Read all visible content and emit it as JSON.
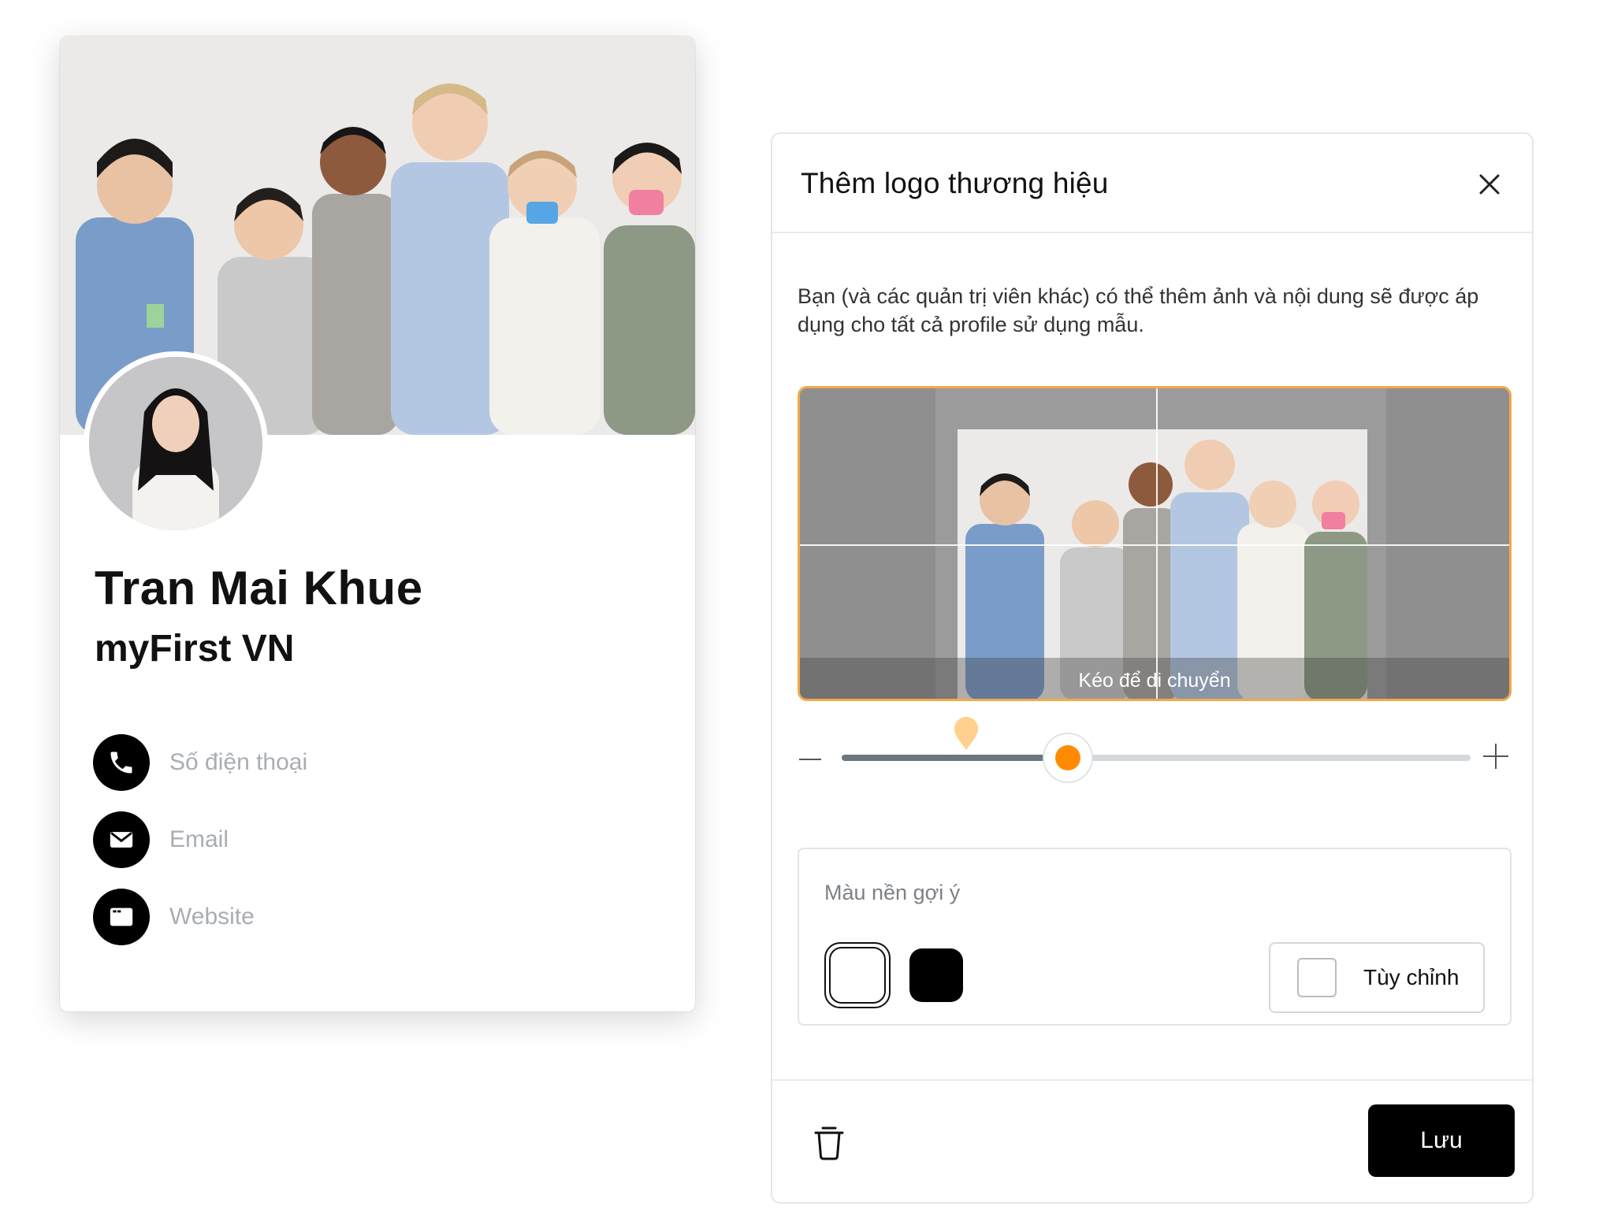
{
  "profile": {
    "name": "Tran Mai Khue",
    "company": "myFirst VN",
    "contacts": [
      {
        "label": "Số điện thoại",
        "icon": "phone-icon"
      },
      {
        "label": "Email",
        "icon": "email-icon"
      },
      {
        "label": "Website",
        "icon": "website-icon"
      }
    ]
  },
  "dialog": {
    "title": "Thêm logo thương hiệu",
    "description": "Bạn (và các quản trị viên khác) có thể thêm ảnh và nội dung sẽ được áp dụng cho tất cả profile sử dụng mẫu.",
    "drag_hint": "Kéo để di chuyển",
    "zoom_level": 0.36,
    "colors_label": "Màu nền gợi ý",
    "swatches": [
      "#ffffff",
      "#000000"
    ],
    "custom_label": "Tùy chỉnh",
    "save_label": "Lưu"
  },
  "colors": {
    "accent": "#ff8c00",
    "crop_border": "#f3a94a",
    "primary_button": "#000000"
  }
}
